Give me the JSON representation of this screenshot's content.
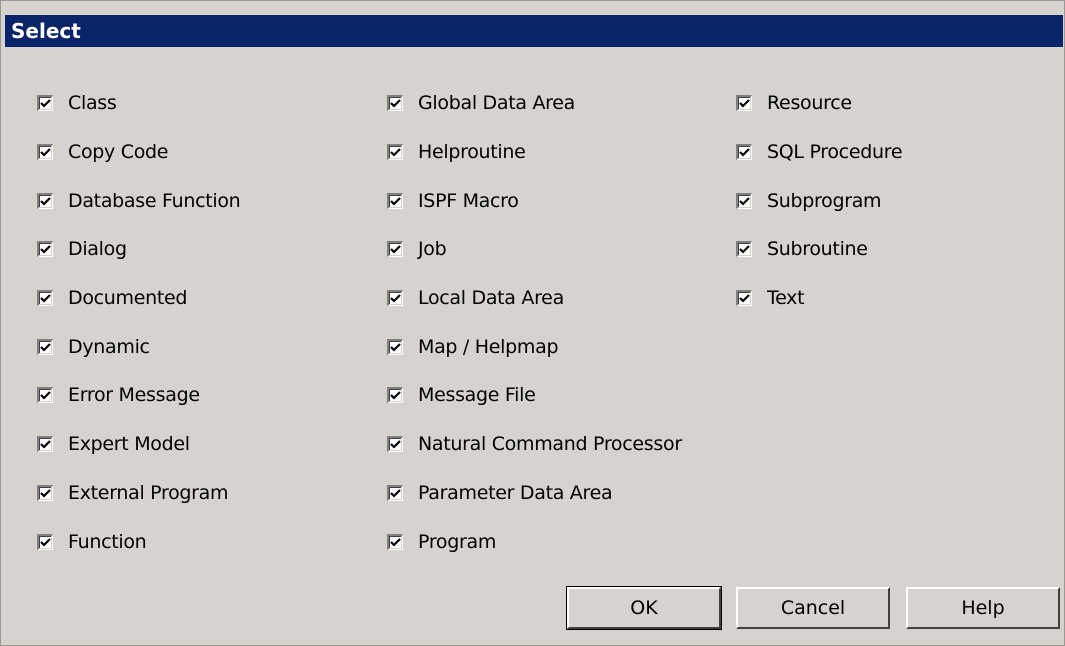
{
  "window": {
    "title": "Select"
  },
  "columns": [
    {
      "items": [
        {
          "label": "Class",
          "checked": true
        },
        {
          "label": "Copy Code",
          "checked": true
        },
        {
          "label": "Database Function",
          "checked": true
        },
        {
          "label": "Dialog",
          "checked": true
        },
        {
          "label": "Documented",
          "checked": true
        },
        {
          "label": "Dynamic",
          "checked": true
        },
        {
          "label": "Error Message",
          "checked": true
        },
        {
          "label": "Expert Model",
          "checked": true
        },
        {
          "label": "External Program",
          "checked": true
        },
        {
          "label": "Function",
          "checked": true
        }
      ]
    },
    {
      "items": [
        {
          "label": "Global Data Area",
          "checked": true
        },
        {
          "label": "Helproutine",
          "checked": true
        },
        {
          "label": "ISPF Macro",
          "checked": true
        },
        {
          "label": "Job",
          "checked": true
        },
        {
          "label": "Local Data Area",
          "checked": true
        },
        {
          "label": "Map / Helpmap",
          "checked": true
        },
        {
          "label": "Message File",
          "checked": true
        },
        {
          "label": "Natural Command Processor",
          "checked": true
        },
        {
          "label": "Parameter Data Area",
          "checked": true
        },
        {
          "label": "Program",
          "checked": true
        }
      ]
    },
    {
      "items": [
        {
          "label": "Resource",
          "checked": true
        },
        {
          "label": "SQL Procedure",
          "checked": true
        },
        {
          "label": "Subprogram",
          "checked": true
        },
        {
          "label": "Subroutine",
          "checked": true
        },
        {
          "label": "Text",
          "checked": true
        }
      ]
    }
  ],
  "buttons": {
    "ok_label": "OK",
    "cancel_label": "Cancel",
    "help_label": "Help"
  },
  "colors": {
    "titlebar": "#0a246a",
    "dialog_bg": "#d6d3ce"
  },
  "icons": {
    "checkbox": "checkmark-icon"
  }
}
